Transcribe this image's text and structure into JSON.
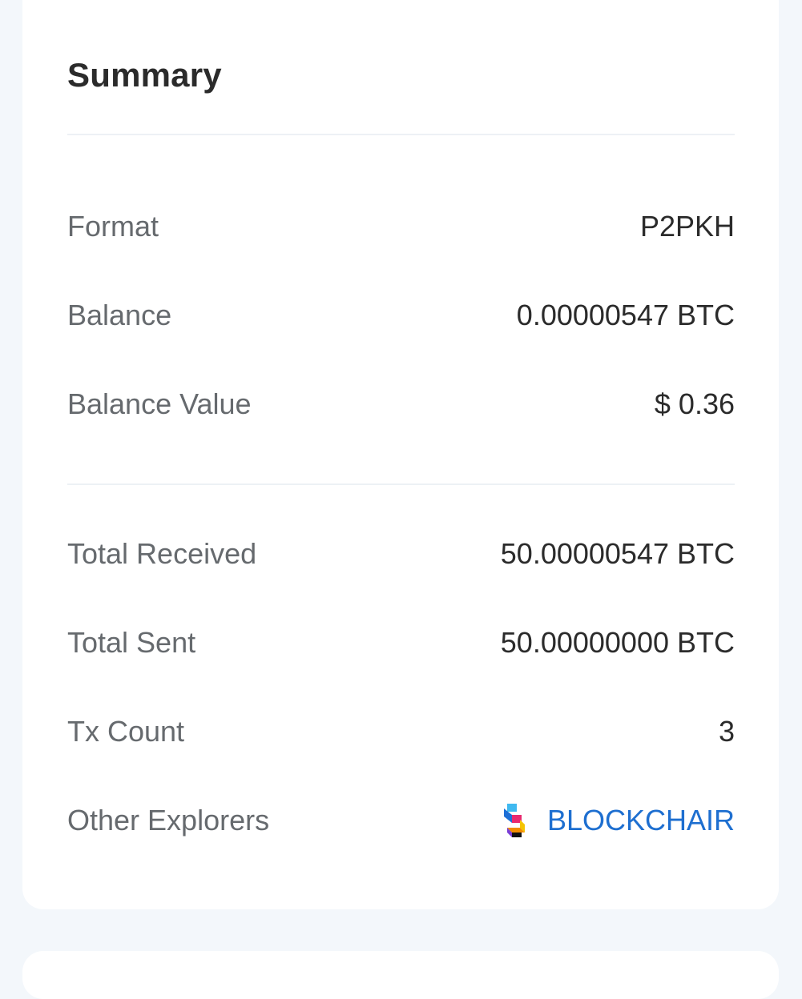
{
  "summary": {
    "title": "Summary",
    "rows_top": [
      {
        "label": "Format",
        "value": "P2PKH"
      },
      {
        "label": "Balance",
        "value": "0.00000547 BTC"
      },
      {
        "label": "Balance Value",
        "value": "$ 0.36"
      }
    ],
    "rows_bottom": [
      {
        "label": "Total Received",
        "value": "50.00000547 BTC"
      },
      {
        "label": "Total Sent",
        "value": "50.00000000 BTC"
      },
      {
        "label": "Tx Count",
        "value": "3"
      }
    ],
    "other_explorers": {
      "label": "Other Explorers",
      "link_label": "BLOCKCHAIR",
      "icon": "blockchair-logo-icon",
      "link_color": "#1e6fd0"
    }
  }
}
